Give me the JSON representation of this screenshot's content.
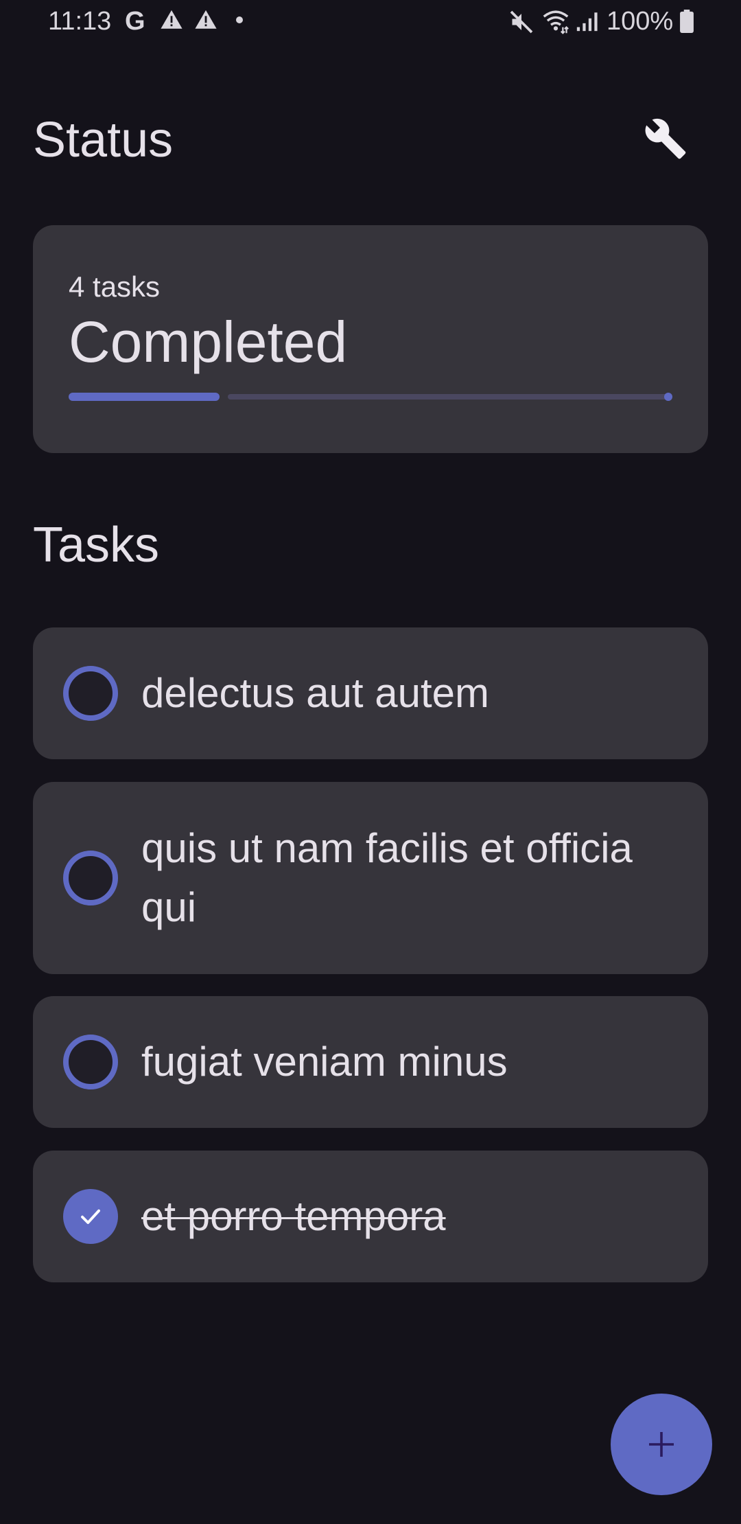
{
  "status_bar": {
    "time": "11:13",
    "g_label": "G",
    "battery_pct": "100%",
    "icons": [
      "google-icon",
      "warning-icon",
      "warning-icon",
      "notification-dot-icon",
      "mute-icon",
      "wifi-icon",
      "signal-icon",
      "battery-icon"
    ]
  },
  "header": {
    "title": "Status",
    "settings_icon": "wrench-icon"
  },
  "status_card": {
    "task_count": "4 tasks",
    "label": "Completed",
    "progress": 0.25,
    "accent_color": "#5f6ac4"
  },
  "tasks_section": {
    "title": "Tasks",
    "items": [
      {
        "label": "delectus aut autem",
        "completed": false
      },
      {
        "label": "quis ut nam facilis et officia qui",
        "completed": false
      },
      {
        "label": "fugiat veniam minus",
        "completed": false
      },
      {
        "label": "et porro tempora",
        "completed": true
      }
    ]
  },
  "fab": {
    "icon": "plus-icon"
  },
  "colors": {
    "background": "#14121a",
    "card": "#36343b",
    "accent": "#5f6ac4",
    "text": "#e6e1e9"
  }
}
